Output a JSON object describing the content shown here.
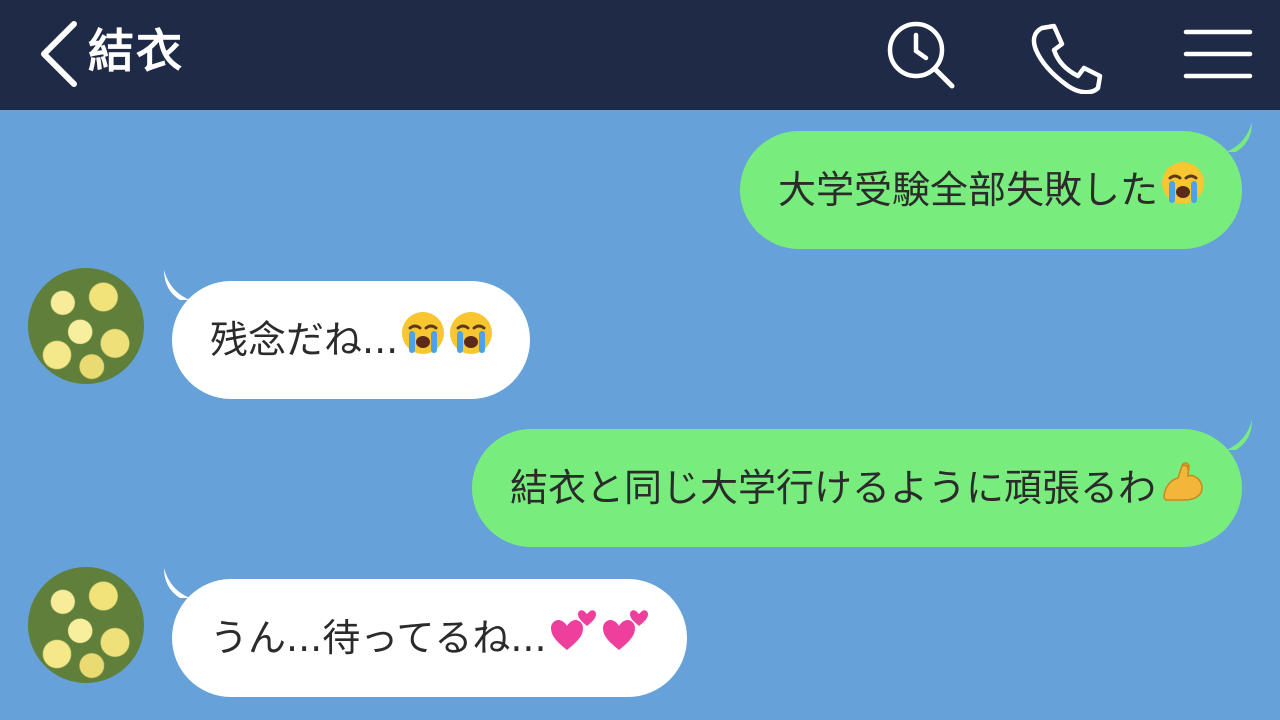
{
  "header": {
    "contact_name": "結衣",
    "icons": {
      "back": "chevron-left-icon",
      "search": "search-icon",
      "call": "phone-icon",
      "menu": "hamburger-menu-icon"
    },
    "colors": {
      "bar": "#1f2a46",
      "icon": "#ffffff"
    }
  },
  "chat": {
    "background": "#66a1d9",
    "messages": [
      {
        "side": "sent",
        "text": "大学受験全部失敗した",
        "emojis": [
          "loudly-crying-face"
        ]
      },
      {
        "side": "received",
        "text": "残念だね...",
        "emojis": [
          "loudly-crying-face",
          "loudly-crying-face"
        ]
      },
      {
        "side": "sent",
        "text": "結衣と同じ大学行けるように頑張るわ",
        "emojis": [
          "flexed-biceps"
        ]
      },
      {
        "side": "received",
        "text": "うん...待ってるね...",
        "emojis": [
          "two-hearts",
          "two-hearts"
        ]
      }
    ],
    "colors": {
      "sent_bubble": "#79ec7e",
      "received_bubble": "#ffffff"
    }
  }
}
